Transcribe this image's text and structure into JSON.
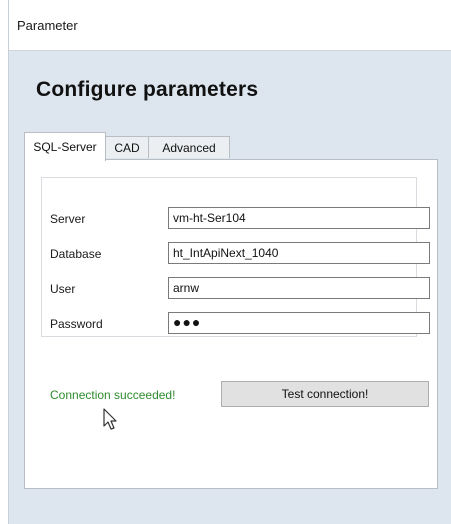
{
  "window": {
    "title": "Parameter"
  },
  "heading": "Configure parameters",
  "tabs": [
    {
      "label": "SQL-Server",
      "active": true
    },
    {
      "label": "CAD",
      "active": false
    },
    {
      "label": "Advanced",
      "active": false
    }
  ],
  "fields": {
    "server": {
      "label": "Server",
      "value": "vm-ht-Ser104"
    },
    "database": {
      "label": "Database",
      "value": "ht_IntApiNext_1040"
    },
    "user": {
      "label": "User",
      "value": "arnw"
    },
    "password": {
      "label": "Password",
      "value": "●●●"
    }
  },
  "status": {
    "text": "Connection succeeded!",
    "color": "#2e8b2e"
  },
  "test_button": {
    "label": "Test connection!"
  },
  "cursor": {
    "icon": "mouse-pointer-icon"
  }
}
